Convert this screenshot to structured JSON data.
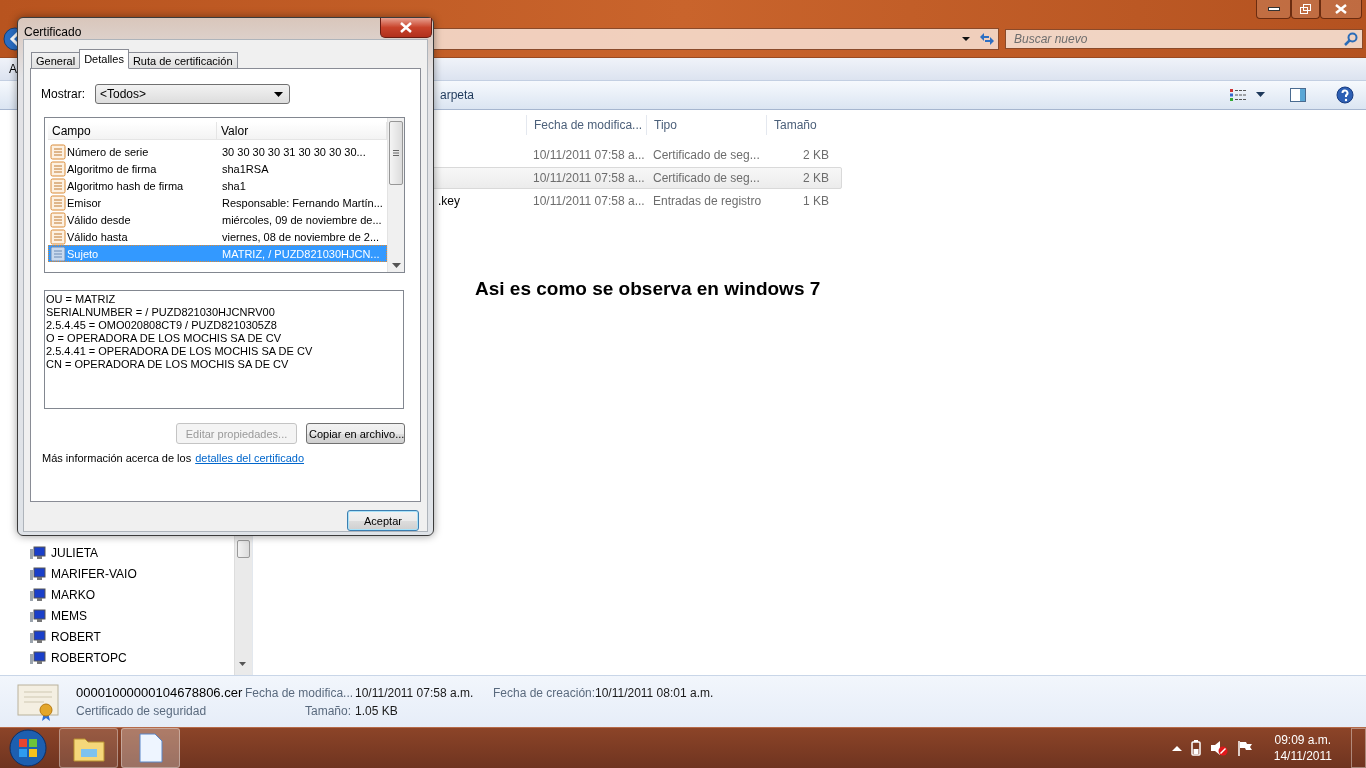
{
  "explorer": {
    "search": {
      "placeholder": "Buscar nuevo"
    },
    "menu_bar": [
      "A"
    ],
    "toolbar": {
      "items": [
        "arpeta"
      ]
    },
    "columns": [
      "Fecha de modifica...",
      "Tipo",
      "Tamaño"
    ],
    "files": [
      {
        "modified": "10/11/2011 07:58 a...",
        "type": "Certificado de seg...",
        "size": "2 KB",
        "selected": false
      },
      {
        "modified": "10/11/2011 07:58 a...",
        "type": "Certificado de seg...",
        "size": "2 KB",
        "selected": true
      },
      {
        "name": ".key",
        "modified": "10/11/2011 07:58 a...",
        "type": "Entradas de registro",
        "size": "1 KB",
        "selected": false
      }
    ],
    "sidebar": {
      "items": [
        "JULIETA",
        "MARIFER-VAIO",
        "MARKO",
        "MEMS",
        "ROBERT",
        "ROBERTOPC"
      ]
    },
    "annotation": "Asi es como se observa en windows 7",
    "details_pane": {
      "file_name": "00001000000104678806.cer",
      "file_type": "Certificado de seguridad",
      "fields": [
        {
          "label": "Fecha de modifica...",
          "value": "10/11/2011 07:58 a.m."
        },
        {
          "label": "Fecha de creación:",
          "value": "10/11/2011 08:01 a.m."
        },
        {
          "label": "Tamaño:",
          "value": "1.05 KB"
        }
      ]
    }
  },
  "dialog": {
    "title": "Certificado",
    "tabs": [
      {
        "label": "General",
        "selected": false
      },
      {
        "label": "Detalles",
        "selected": true
      },
      {
        "label": "Ruta de certificación",
        "selected": false
      }
    ],
    "show": {
      "label": "Mostrar:",
      "value": "<Todos>"
    },
    "fields_table": {
      "columns": [
        "Campo",
        "Valor"
      ],
      "rows": [
        {
          "field": "Número de serie",
          "value": "30 30 30 30 31 30 30 30 30...",
          "selected": false
        },
        {
          "field": "Algoritmo de firma",
          "value": "sha1RSA",
          "selected": false
        },
        {
          "field": "Algoritmo hash de firma",
          "value": "sha1",
          "selected": false
        },
        {
          "field": "Emisor",
          "value": "Responsable: Fernando Martín...",
          "selected": false
        },
        {
          "field": "Válido desde",
          "value": "miércoles, 09 de noviembre de...",
          "selected": false
        },
        {
          "field": "Válido hasta",
          "value": "viernes, 08 de noviembre de 2...",
          "selected": false
        },
        {
          "field": "Sujeto",
          "value": "MATRIZ,  / PUZD821030HJCN...",
          "selected": true
        }
      ]
    },
    "detail_lines": [
      "OU = MATRIZ",
      "SERIALNUMBER =  / PUZD821030HJCNRV00",
      "2.5.4.45 = OMO020808CT9 / PUZD8210305Z8",
      "O = OPERADORA DE LOS MOCHIS SA DE CV",
      "2.5.4.41 = OPERADORA DE LOS MOCHIS SA DE CV",
      "CN = OPERADORA DE LOS MOCHIS SA DE CV"
    ],
    "buttons": [
      {
        "label": "Editar propiedades...",
        "disabled": true
      },
      {
        "label": "Copiar en archivo...",
        "disabled": false
      }
    ],
    "info": {
      "text": "Más información acerca de los",
      "link": "detalles del certificado"
    },
    "ok_button": "Aceptar"
  },
  "taskbar": {
    "apps": [
      {
        "kind": "folder",
        "selected": false
      },
      {
        "kind": "document",
        "selected": true
      }
    ],
    "clock": {
      "time": "09:09 a.m.",
      "date": "14/11/2011"
    }
  }
}
